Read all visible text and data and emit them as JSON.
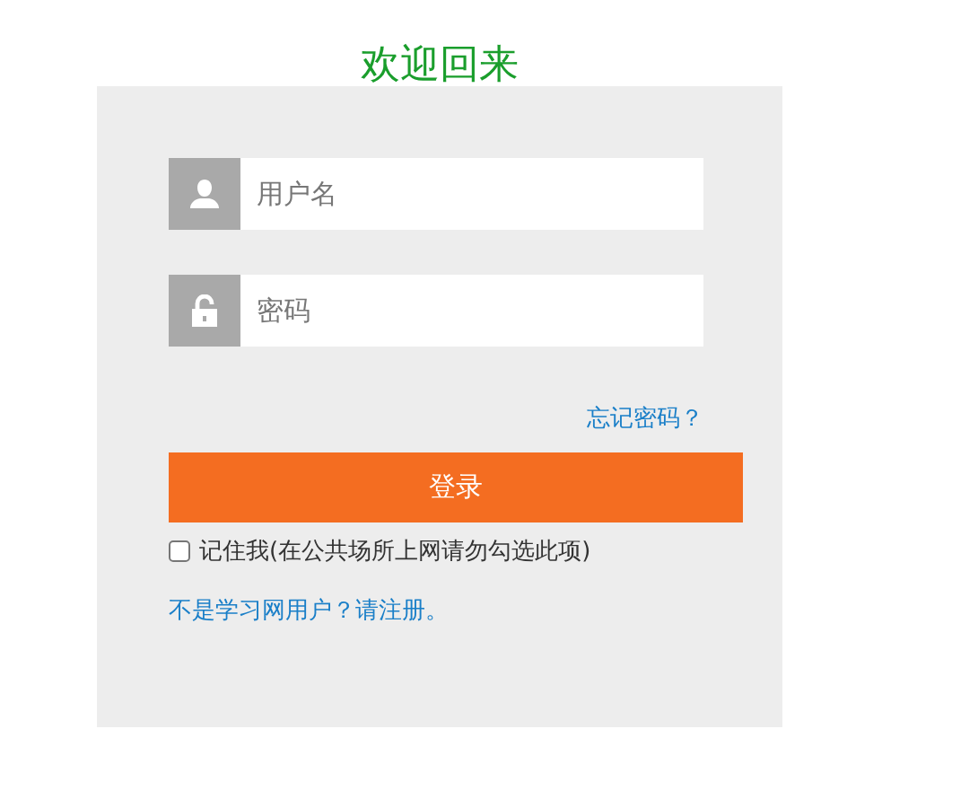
{
  "title": "欢迎回来",
  "fields": [
    {
      "kind": "user",
      "placeholder": "用户名"
    },
    {
      "kind": "lock",
      "placeholder": "密码"
    }
  ],
  "forgot_link": "忘记密码？",
  "login_button": "登录",
  "remember": {
    "label": "记住我(在公共场所上网请勿勾选此项)",
    "checked": false
  },
  "register_link": "不是学习网用户？请注册。"
}
